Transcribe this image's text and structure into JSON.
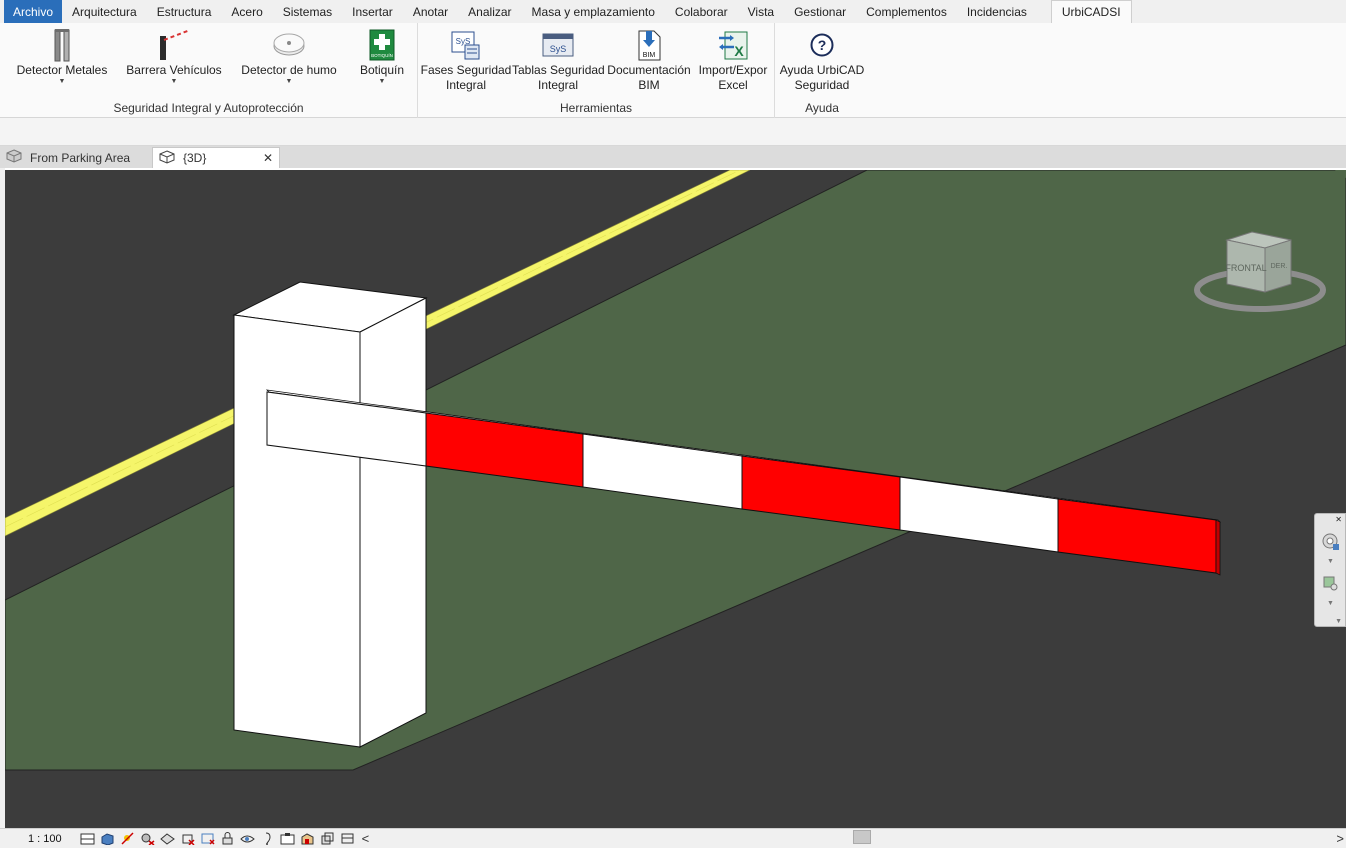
{
  "menu": {
    "tabs": [
      "Archivo",
      "Arquitectura",
      "Estructura",
      "Acero",
      "Sistemas",
      "Insertar",
      "Anotar",
      "Analizar",
      "Masa y emplazamiento",
      "Colaborar",
      "Vista",
      "Gestionar",
      "Complementos",
      "Incidencias"
    ],
    "active_tab": "UrbiCADSI"
  },
  "ribbon": {
    "panel_seguridad": {
      "label": "Seguridad Integral y Autoprotección",
      "buttons": [
        {
          "label": "Detector Metales",
          "icon": "metal-detector-icon"
        },
        {
          "label": "Barrera Vehículos",
          "icon": "vehicle-barrier-icon"
        },
        {
          "label": "Detector de humo",
          "icon": "smoke-detector-icon"
        },
        {
          "label": "Botiquín",
          "icon": "first-aid-kit-icon",
          "icon_text": "BOTIQUÍN"
        }
      ]
    },
    "panel_herramientas": {
      "label": "Herramientas",
      "buttons": [
        {
          "line1": "Fases Seguridad",
          "line2": "Integral",
          "icon": "phases-icon",
          "icon_text": "SyS"
        },
        {
          "line1": "Tablas Seguridad",
          "line2": "Integral",
          "icon": "tables-icon",
          "icon_text": "SyS"
        },
        {
          "line1": "Documentación",
          "line2": "BIM",
          "icon": "bim-docs-icon",
          "icon_text": "BIM"
        },
        {
          "line1": "Import/Expor",
          "line2": "Excel",
          "icon": "excel-icon"
        }
      ]
    },
    "panel_ayuda": {
      "label": "Ayuda",
      "buttons": [
        {
          "line1": "Ayuda UrbiCAD",
          "line2": "Seguridad",
          "icon": "help-icon"
        }
      ]
    }
  },
  "view_tabs": [
    {
      "label": "From Parking Area",
      "active": false,
      "icon": "3d-view-icon"
    },
    {
      "label": "{3D}",
      "active": true,
      "icon": "3d-view-icon",
      "close": "✕"
    }
  ],
  "viewcube": {
    "front_label": "FRONTAL",
    "right_label": "DER."
  },
  "status": {
    "scale": "1 : 100",
    "scroll_left": "<",
    "scroll_right": ">"
  },
  "colors": {
    "accent": "#2a6eba",
    "grass": "#4f6648",
    "asphalt": "#3c3c3c",
    "line": "#f5f56a",
    "barrier_red": "#ff0000"
  }
}
